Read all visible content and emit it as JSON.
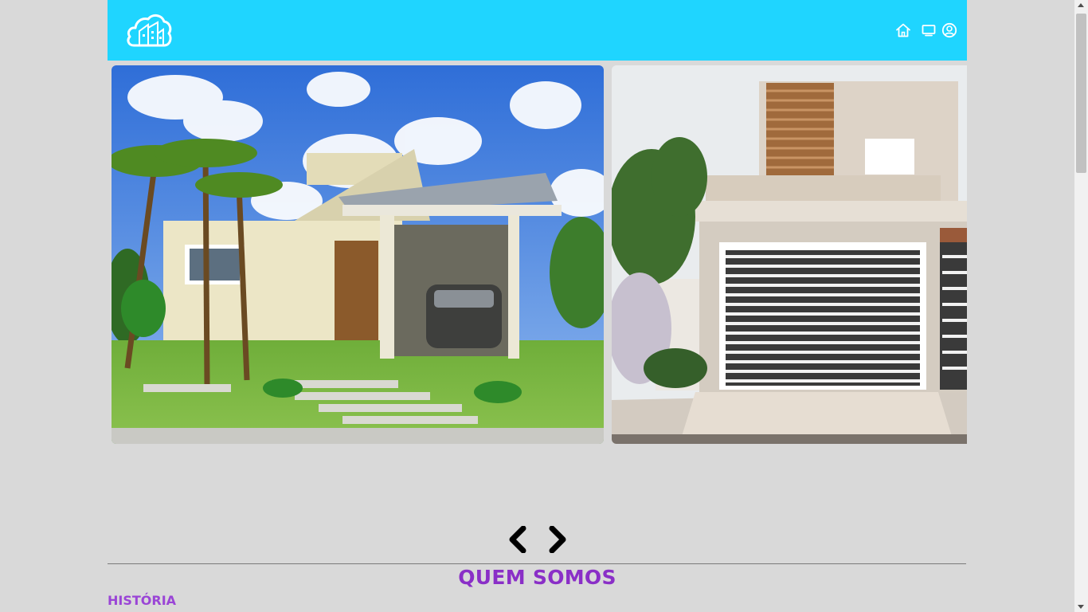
{
  "header": {
    "logo_icon": "cloud-house-logo",
    "nav": [
      {
        "icon": "home-icon"
      },
      {
        "icon": "monitor-icon"
      },
      {
        "icon": "user-circle-icon"
      }
    ],
    "background": "#1fd5ff"
  },
  "carousel": {
    "slides": [
      {
        "subject": "single-storey house with palm trees and carport"
      },
      {
        "subject": "two-storey modern house with slatted garage gate"
      }
    ],
    "prev_icon": "chevron-left-icon",
    "next_icon": "chevron-right-icon"
  },
  "about": {
    "title": "QUEM SOMOS",
    "subheading": "HISTÓRIA",
    "title_color": "#8a2fc7"
  }
}
